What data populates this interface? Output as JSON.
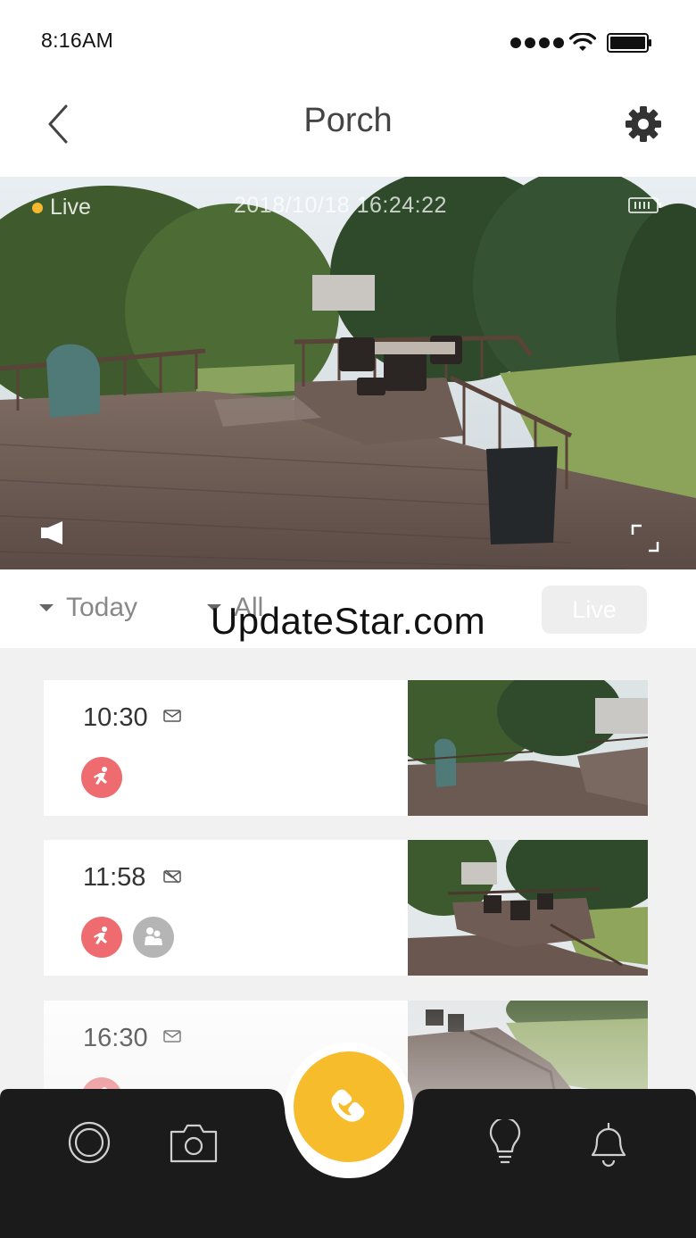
{
  "status_bar": {
    "time": "8:16AM"
  },
  "nav": {
    "title": "Porch"
  },
  "video": {
    "live_label": "Live",
    "timestamp": "2018/10/18 16:24:22",
    "accent_color": "#f5b82e"
  },
  "filters": {
    "date_label": "Today",
    "type_label": "All",
    "live_button_label": "Live"
  },
  "watermark": "UpdateStar.com",
  "events": [
    {
      "time": "10:30",
      "message_icon": "envelope-icon",
      "tags": [
        "motion"
      ]
    },
    {
      "time": "11:58",
      "message_icon": "envelope-crossed-icon",
      "tags": [
        "motion",
        "person"
      ]
    },
    {
      "time": "16:30",
      "message_icon": "envelope-icon",
      "tags": [
        "motion"
      ]
    }
  ],
  "tab_bar": {
    "items": [
      "record-icon",
      "camera-icon",
      "call-icon",
      "light-bulb-icon",
      "bell-icon"
    ],
    "call_color": "#f6bc2c",
    "motion_color": "#ee6b6f"
  }
}
